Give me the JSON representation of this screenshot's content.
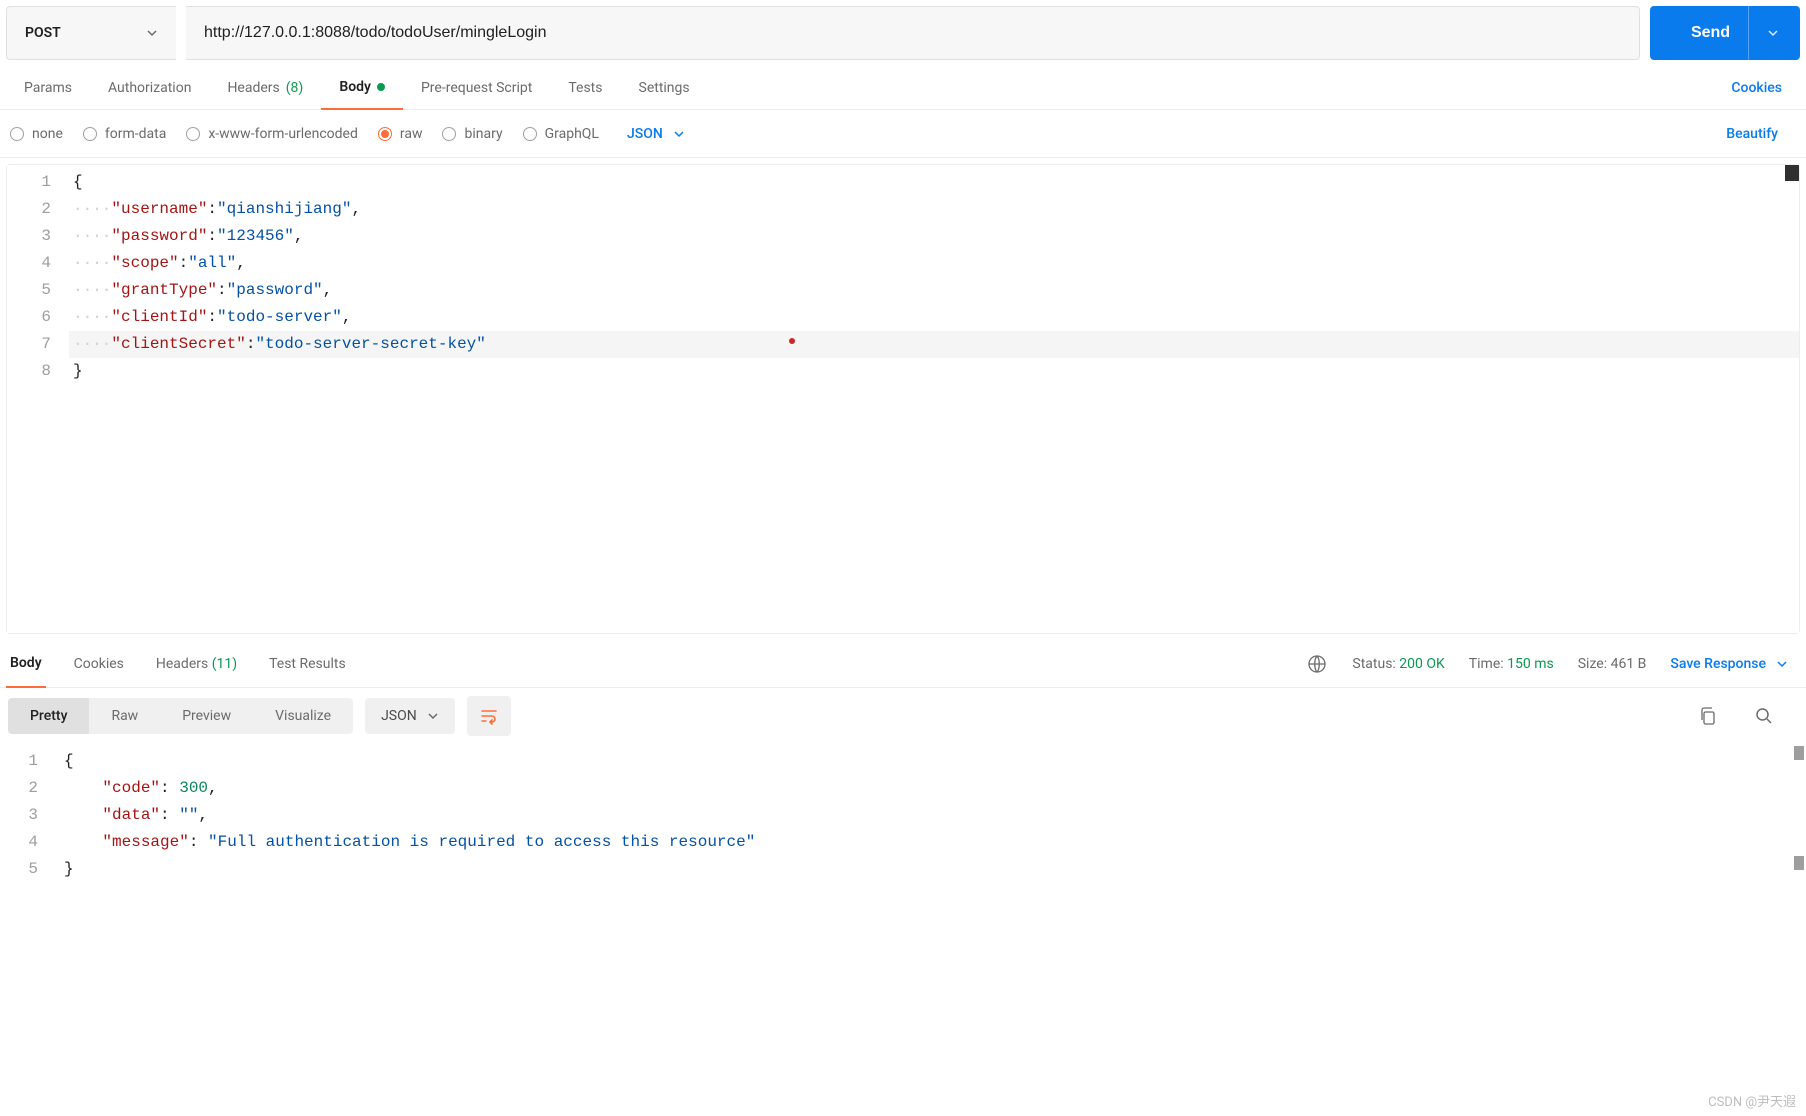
{
  "request": {
    "method": "POST",
    "url": "http://127.0.0.1:8088/todo/todoUser/mingleLogin",
    "send_label": "Send"
  },
  "tabs": {
    "params": "Params",
    "authorization": "Authorization",
    "headers_label": "Headers",
    "headers_count": "(8)",
    "body": "Body",
    "prerequest": "Pre-request Script",
    "tests": "Tests",
    "settings": "Settings",
    "cookies": "Cookies"
  },
  "body_types": {
    "none": "none",
    "formdata": "form-data",
    "urlencoded": "x-www-form-urlencoded",
    "raw": "raw",
    "binary": "binary",
    "graphql": "GraphQL",
    "content_type": "JSON",
    "beautify": "Beautify"
  },
  "editor": {
    "line_numbers": [
      "1",
      "2",
      "3",
      "4",
      "5",
      "6",
      "7",
      "8"
    ],
    "indent": "····",
    "open_brace": "{",
    "close_brace": "}",
    "lines": [
      {
        "key": "\"username\"",
        "value": "\"qianshijiang\"",
        "comma": ","
      },
      {
        "key": "\"password\"",
        "value": "\"123456\"",
        "comma": ","
      },
      {
        "key": "\"scope\"",
        "value": "\"all\"",
        "comma": ","
      },
      {
        "key": "\"grantType\"",
        "value": "\"password\"",
        "comma": ","
      },
      {
        "key": "\"clientId\"",
        "value": "\"todo-server\"",
        "comma": ","
      },
      {
        "key": "\"clientSecret\"",
        "value": "\"todo-server-secret-key\"",
        "comma": ""
      }
    ]
  },
  "response_tabs": {
    "body": "Body",
    "cookies": "Cookies",
    "headers_label": "Headers",
    "headers_count": "(11)",
    "test_results": "Test Results"
  },
  "response_meta": {
    "status_label": "Status:",
    "status_value": "200 OK",
    "time_label": "Time:",
    "time_value": "150 ms",
    "size_label": "Size:",
    "size_value": "461 B",
    "save": "Save Response"
  },
  "response_toolbar": {
    "pretty": "Pretty",
    "raw": "Raw",
    "preview": "Preview",
    "visualize": "Visualize",
    "content_type": "JSON"
  },
  "response_body": {
    "line_numbers": [
      "1",
      "2",
      "3",
      "4",
      "5"
    ],
    "indent4": "    ",
    "open_brace": "{",
    "close_brace": "}",
    "lines": [
      {
        "key": "\"code\"",
        "value": "300",
        "type": "num",
        "comma": ","
      },
      {
        "key": "\"data\"",
        "value": "\"\"",
        "type": "str",
        "comma": ","
      },
      {
        "key": "\"message\"",
        "value": "\"Full authentication is required to access this resource\"",
        "type": "str",
        "comma": ""
      }
    ]
  },
  "watermark": "CSDN @尹天遐"
}
